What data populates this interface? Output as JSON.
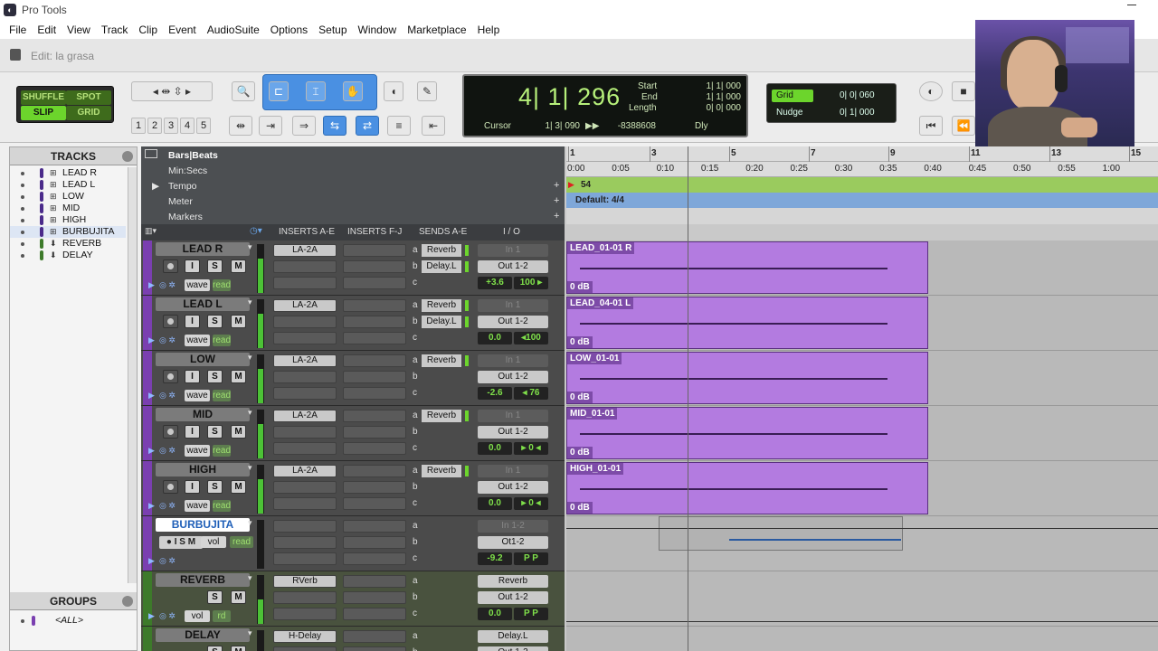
{
  "app": {
    "title": "Pro Tools"
  },
  "menu": [
    "File",
    "Edit",
    "View",
    "Track",
    "Clip",
    "Event",
    "AudioSuite",
    "Options",
    "Setup",
    "Window",
    "Marketplace",
    "Help"
  ],
  "editbar": {
    "title": "Edit: la grasa"
  },
  "modes": {
    "shuffle": "SHUFFLE",
    "spot": "SPOT",
    "slip": "SLIP",
    "grid": "GRID"
  },
  "zoom_presets": [
    "1",
    "2",
    "3",
    "4",
    "5"
  ],
  "counter": {
    "main": "4| 1| 296",
    "start_label": "Start",
    "end_label": "End",
    "length_label": "Length",
    "start": "1| 1| 000",
    "end": "1| 1| 000",
    "length": "0| 0| 000",
    "cursor_label": "Cursor",
    "cursor": "1| 3| 090",
    "cursor_value": "-8388608",
    "dly": "Dly"
  },
  "grid": {
    "grid_label": "Grid",
    "grid_value": "0| 0| 060",
    "nudge_label": "Nudge",
    "nudge_value": "0| 1| 000"
  },
  "tracks_panel": {
    "title": "TRACKS",
    "items": [
      "LEAD R",
      "LEAD L",
      "LOW",
      "MID",
      "HIGH",
      "BURBUJITA",
      "REVERB",
      "DELAY"
    ]
  },
  "groups_panel": {
    "title": "GROUPS",
    "all": "<ALL>"
  },
  "rulers": {
    "bars": "Bars|Beats",
    "minsecs": "Min:Secs",
    "tempo": "Tempo",
    "meter": "Meter",
    "markers": "Markers",
    "tempo_value": "54",
    "meter_value": "Default: 4/4",
    "bar_ticks": [
      "1",
      "3",
      "5",
      "7",
      "9",
      "11",
      "13",
      "15"
    ],
    "time_ticks": [
      "0:00",
      "0:05",
      "0:10",
      "0:15",
      "0:20",
      "0:25",
      "0:30",
      "0:35",
      "0:40",
      "0:45",
      "0:50",
      "0:55",
      "1:00"
    ]
  },
  "columns": {
    "inserts_ae": "INSERTS A-E",
    "inserts_fj": "INSERTS F-J",
    "sends": "SENDS A-E",
    "io": "I / O"
  },
  "track_list": [
    {
      "name": "LEAD R",
      "insert": "LA-2A",
      "sends": [
        "Reverb",
        "Delay.L"
      ],
      "io_in": "In 1",
      "io_out": "Out 1-2",
      "vol": "+3.6",
      "pan": "100 ▸",
      "tv": "wave",
      "ar": "read",
      "clip": "LEAD_01-01 R",
      "gain": "0 dB"
    },
    {
      "name": "LEAD L",
      "insert": "LA-2A",
      "sends": [
        "Reverb",
        "Delay.L"
      ],
      "io_in": "In 1",
      "io_out": "Out 1-2",
      "vol": "0.0",
      "pan": "◂100",
      "tv": "wave",
      "ar": "read",
      "clip": "LEAD_04-01 L",
      "gain": "0 dB"
    },
    {
      "name": "LOW",
      "insert": "LA-2A",
      "sends": [
        "Reverb"
      ],
      "io_in": "In 1",
      "io_out": "Out 1-2",
      "vol": "-2.6",
      "pan": "◂ 76",
      "tv": "wave",
      "ar": "read",
      "clip": "LOW_01-01",
      "gain": "0 dB"
    },
    {
      "name": "MID",
      "insert": "LA-2A",
      "sends": [
        "Reverb"
      ],
      "io_in": "In 1",
      "io_out": "Out 1-2",
      "vol": "0.0",
      "pan": "▸ 0 ◂",
      "tv": "wave",
      "ar": "read",
      "clip": "MID_01-01",
      "gain": "0 dB"
    },
    {
      "name": "HIGH",
      "insert": "LA-2A",
      "sends": [
        "Reverb"
      ],
      "io_in": "In 1",
      "io_out": "Out 1-2",
      "vol": "0.0",
      "pan": "▸ 0 ◂",
      "tv": "wave",
      "ar": "read",
      "clip": "HIGH_01-01",
      "gain": "0 dB"
    },
    {
      "name": "BURBUJITA",
      "io_in": "In 1-2",
      "io_out": "Ot1-2",
      "vol": "-9.2",
      "pan": "P P",
      "tv": "vol",
      "ar": "read"
    },
    {
      "name": "REVERB",
      "insert": "RVerb",
      "io_in": "Reverb",
      "io_out": "Out 1-2",
      "vol": "0.0",
      "pan": "P P",
      "tv": "vol",
      "ar": "rd"
    },
    {
      "name": "DELAY",
      "insert": "H-Delay",
      "io_in": "Delay.L",
      "io_out": "Out 1-2"
    }
  ],
  "send_letters": [
    "a",
    "b",
    "c"
  ],
  "track_buttons": {
    "i": "I",
    "s": "S",
    "m": "M"
  },
  "colors": {
    "clip": "#b37be0",
    "accent": "#4a90e2",
    "mode_on": "#6cd52c"
  }
}
